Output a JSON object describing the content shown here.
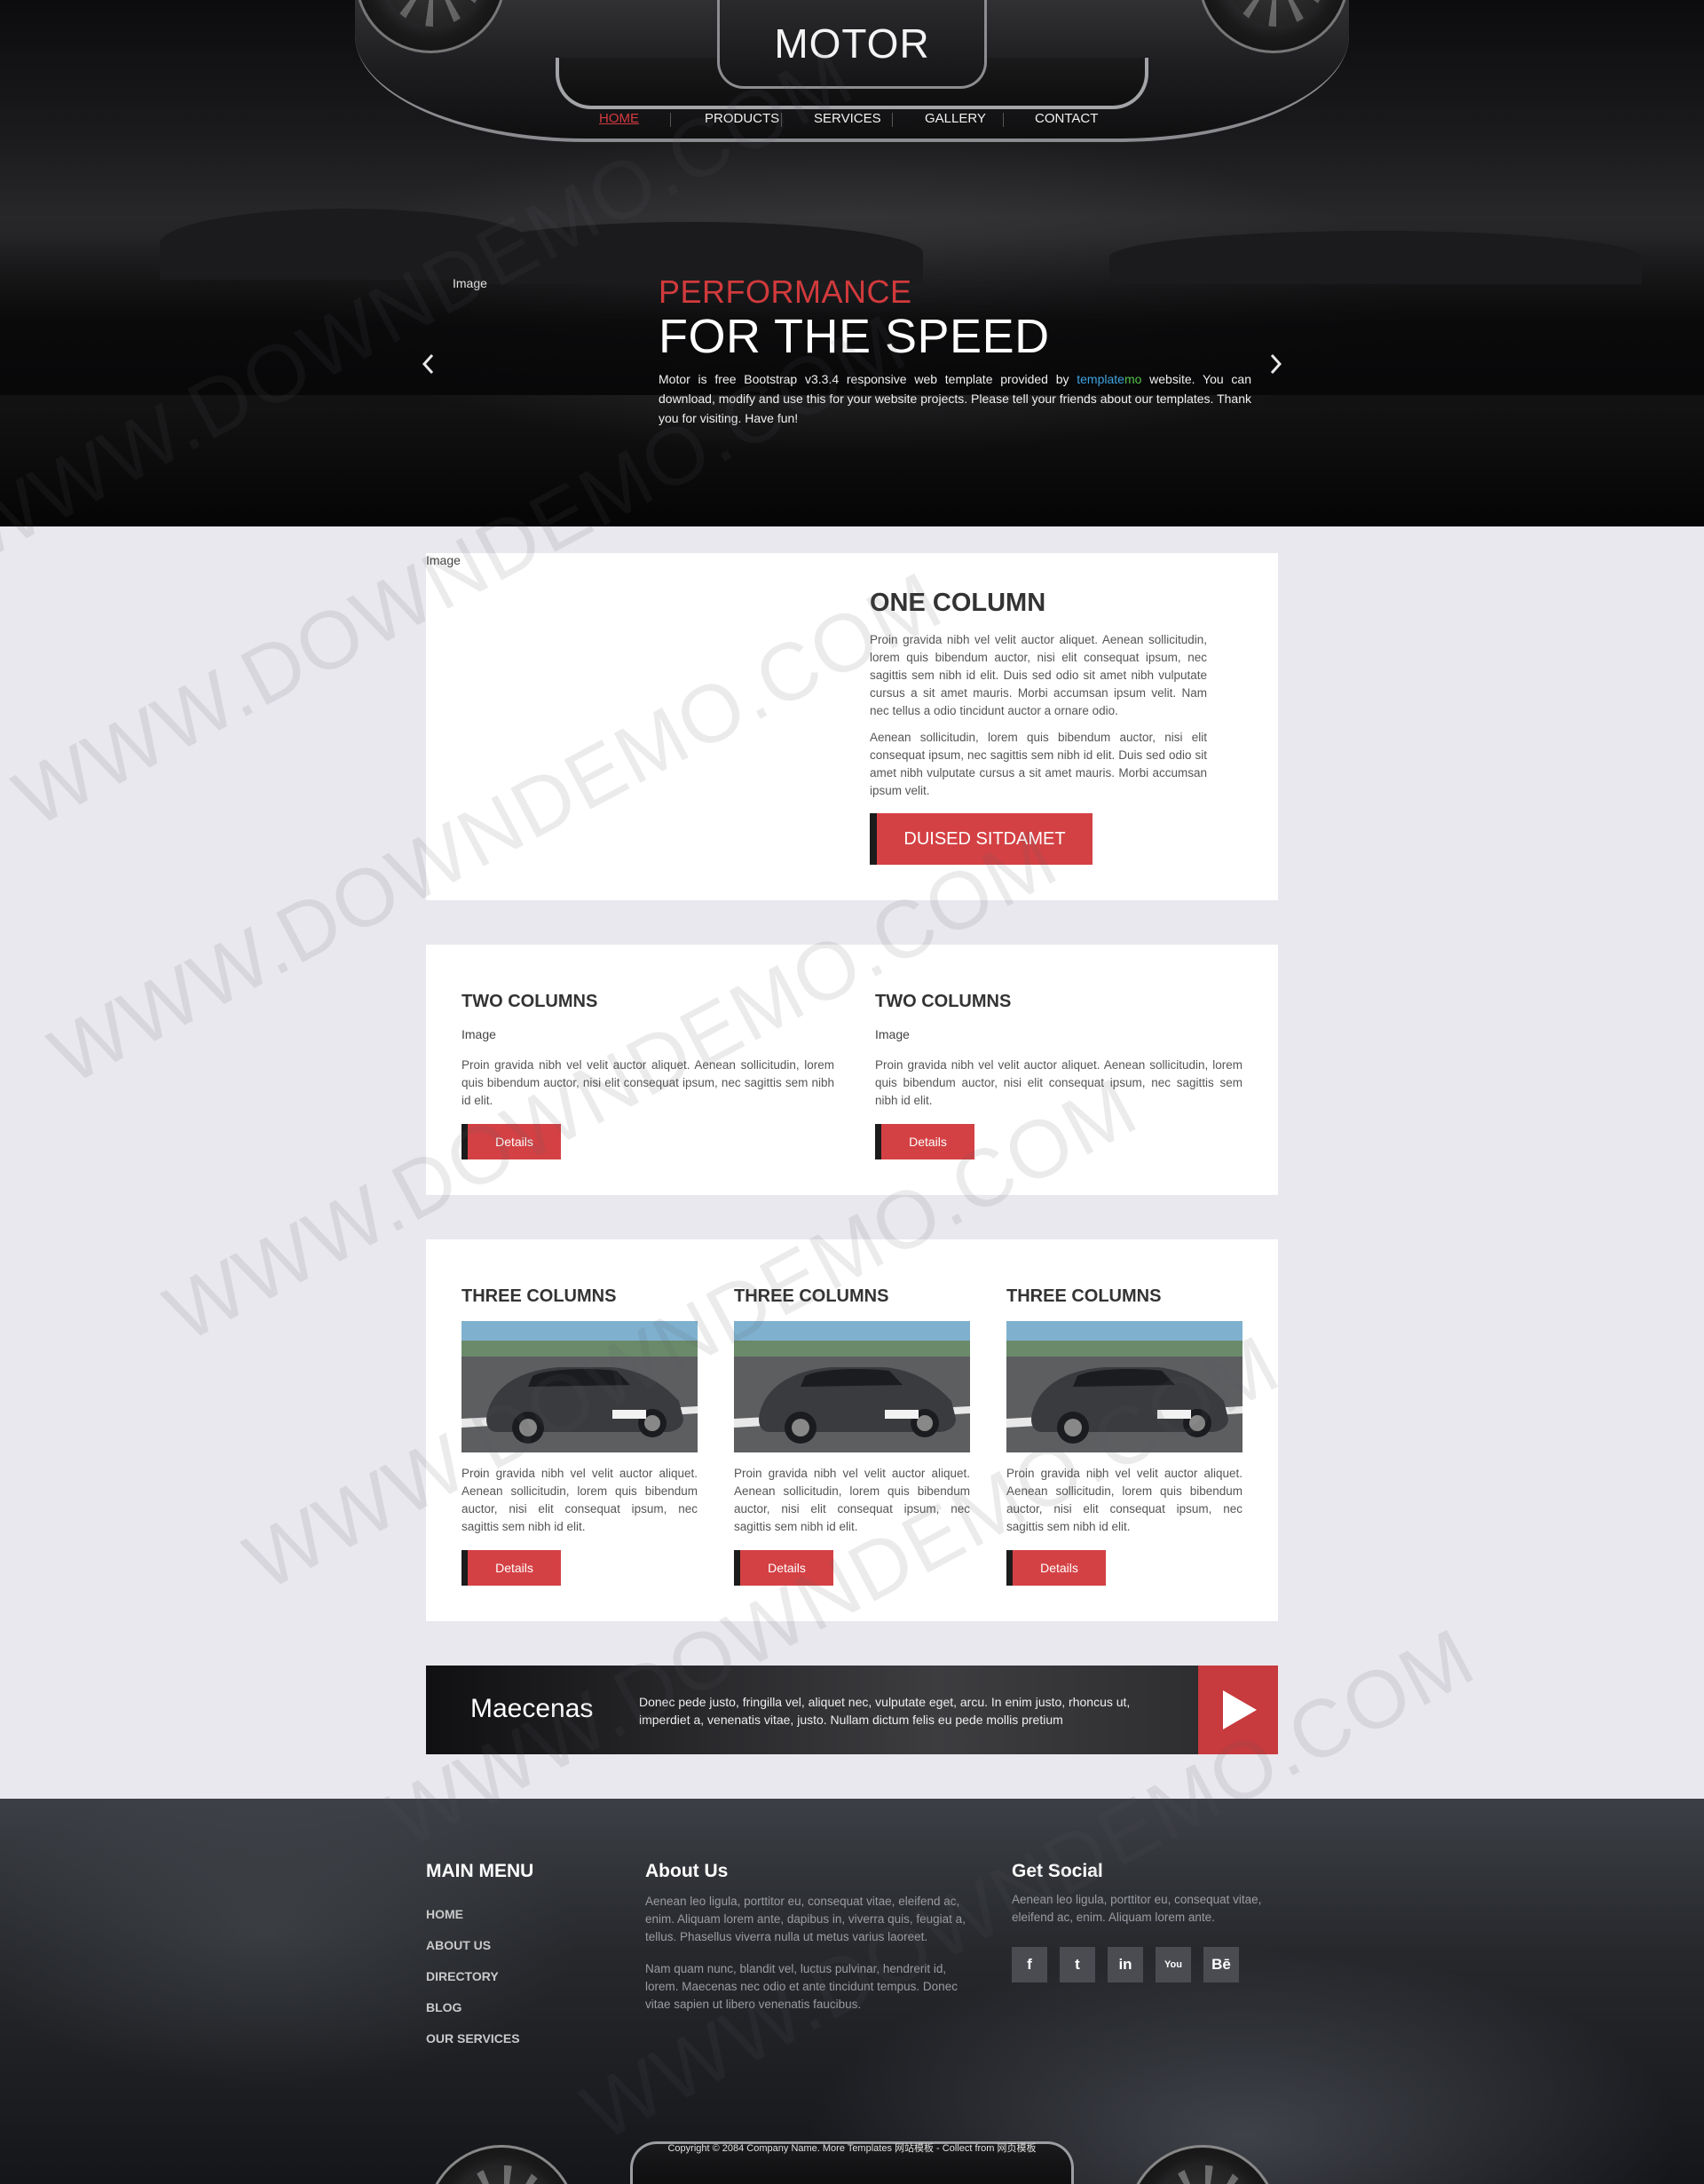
{
  "header": {
    "logo": "MOTOR",
    "nav": [
      {
        "label": "HOME",
        "active": true
      },
      {
        "label": "PRODUCTS",
        "active": false
      },
      {
        "label": "SERVICES",
        "active": false
      },
      {
        "label": "GALLERY",
        "active": false
      },
      {
        "label": "CONTACT",
        "active": false
      }
    ]
  },
  "hero": {
    "image_alt": "Image",
    "subtitle": "PERFORMANCE",
    "title": "FOR THE SPEED",
    "text_before": "Motor is free Bootstrap v3.3.4 responsive web template provided by ",
    "link_part1": "template",
    "link_part2": "mo",
    "text_after": " website. You can download, modify and use this for your website projects. Please tell your friends about our templates. Thank you for visiting. Have fun!",
    "prev_icon": "chevron-left-icon",
    "next_icon": "chevron-right-icon",
    "subtitle_color": "#d23a3c"
  },
  "one_column": {
    "image_alt": "Image",
    "title": "ONE COLUMN",
    "paragraph1": "Proin gravida nibh vel velit auctor aliquet. Aenean sollicitudin, lorem quis bibendum auctor, nisi elit consequat ipsum, nec sagittis sem nibh id elit. Duis sed odio sit amet nibh vulputate cursus a sit amet mauris. Morbi accumsan ipsum velit. Nam nec tellus a odio tincidunt auctor a ornare odio.",
    "paragraph2": "Aenean sollicitudin, lorem quis bibendum auctor, nisi elit consequat ipsum, nec sagittis sem nibh id elit. Duis sed odio sit amet nibh vulputate cursus a sit amet mauris. Morbi accumsan ipsum velit.",
    "button": "DUISED SITDAMET"
  },
  "two_columns": [
    {
      "title": "TWO COLUMNS",
      "image_alt": "Image",
      "text": "Proin gravida nibh vel velit auctor aliquet. Aenean sollicitudin, lorem quis bibendum auctor, nisi elit consequat ipsum, nec sagittis sem nibh id elit.",
      "button": "Details"
    },
    {
      "title": "TWO COLUMNS",
      "image_alt": "Image",
      "text": "Proin gravida nibh vel velit auctor aliquet. Aenean sollicitudin, lorem quis bibendum auctor, nisi elit consequat ipsum, nec sagittis sem nibh id elit.",
      "button": "Details"
    }
  ],
  "three_columns": [
    {
      "title": "THREE COLUMNS",
      "text": "Proin gravida nibh vel velit auctor aliquet. Aenean sollicitudin, lorem quis bibendum auctor, nisi elit consequat ipsum, nec sagittis sem nibh id elit.",
      "button": "Details"
    },
    {
      "title": "THREE COLUMNS",
      "text": "Proin gravida nibh vel velit auctor aliquet. Aenean sollicitudin, lorem quis bibendum auctor, nisi elit consequat ipsum, nec sagittis sem nibh id elit.",
      "button": "Details"
    },
    {
      "title": "THREE COLUMNS",
      "text": "Proin gravida nibh vel velit auctor aliquet. Aenean sollicitudin, lorem quis bibendum auctor, nisi elit consequat ipsum, nec sagittis sem nibh id elit.",
      "button": "Details"
    }
  ],
  "banner": {
    "name": "Maecenas",
    "text": "Donec pede justo, fringilla vel, aliquet nec, vulputate eget, arcu. In enim justo, rhoncus ut, imperdiet a, venenatis vitae, justo. Nullam dictum felis eu pede mollis pretium",
    "play_icon": "play-icon"
  },
  "footer": {
    "menu_title": "MAIN MENU",
    "menu_items": [
      "HOME",
      "ABOUT US",
      "DIRECTORY",
      "BLOG",
      "OUR SERVICES"
    ],
    "about_title": "About Us",
    "about_p1": "Aenean leo ligula, porttitor eu, consequat vitae, eleifend ac, enim. Aliquam lorem ante, dapibus in, viverra quis, feugiat a, tellus. Phasellus viverra nulla ut metus varius laoreet.",
    "about_p2": "Nam quam nunc, blandit vel, luctus pulvinar, hendrerit id, lorem. Maecenas nec odio et ante tincidunt tempus. Donec vitae sapien ut libero venenatis faucibus.",
    "social_title": "Get Social",
    "social_text": "Aenean leo ligula, porttitor eu, consequat vitae, eleifend ac, enim. Aliquam lorem ante.",
    "social_icons": [
      {
        "name": "facebook-icon",
        "glyph": "f"
      },
      {
        "name": "twitter-icon",
        "glyph": "t"
      },
      {
        "name": "linkedin-icon",
        "glyph": "in"
      },
      {
        "name": "youtube-icon",
        "glyph": "You"
      },
      {
        "name": "behance-icon",
        "glyph": "Bē"
      }
    ],
    "copyright": "Copyright © 2084 Company Name. More Templates 网站模板 - Collect from 网页模板"
  },
  "watermark": "WWW.DOWNDEMO.COM",
  "colors": {
    "accent": "#d44144",
    "page_bg": "#e9e8ee"
  }
}
